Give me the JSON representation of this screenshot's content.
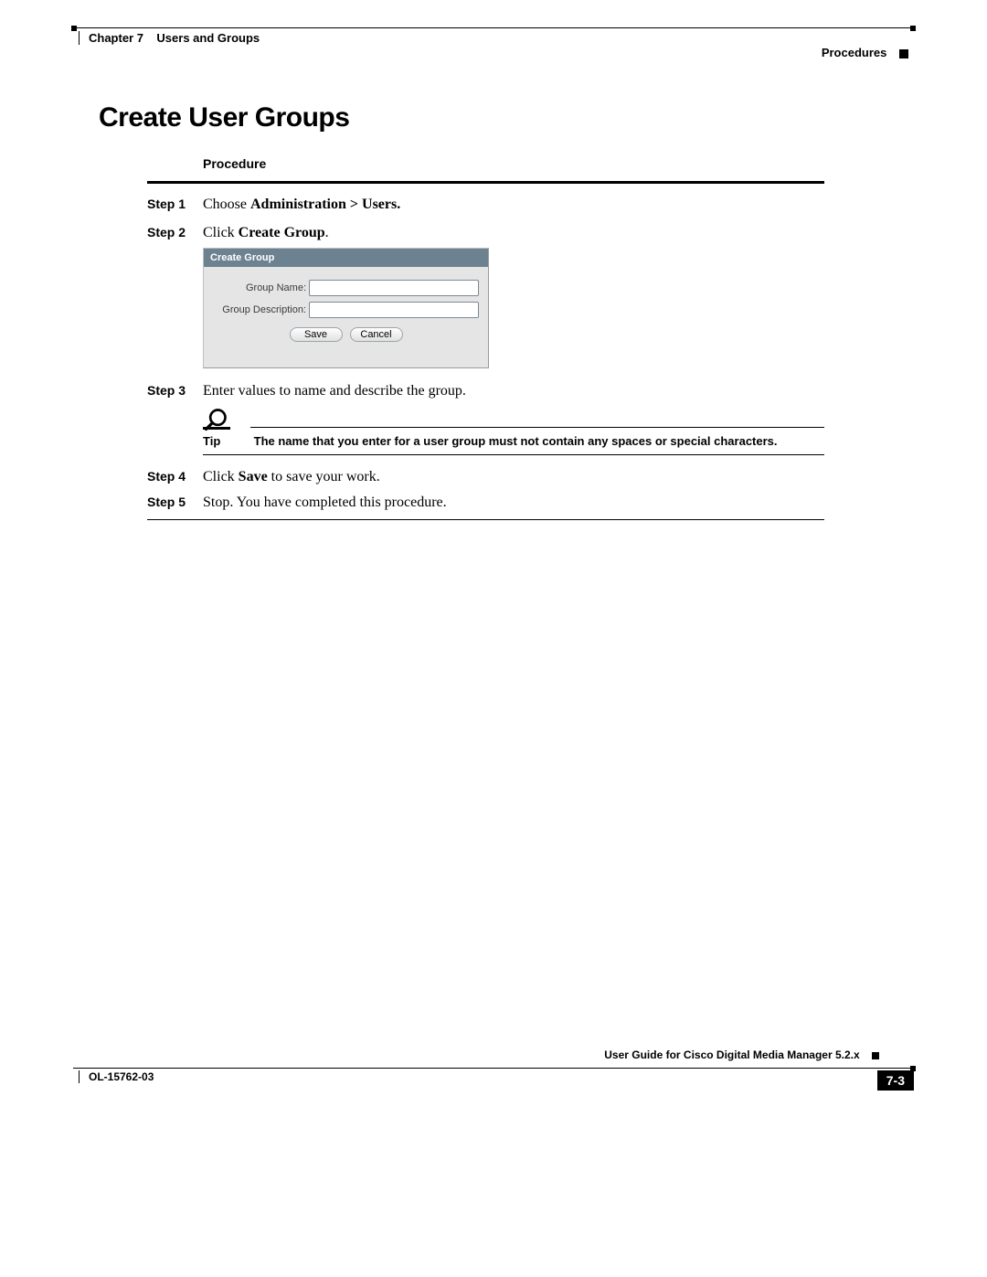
{
  "header": {
    "chapter": "Chapter 7",
    "chapter_title": "Users and Groups",
    "section": "Procedures"
  },
  "title": "Create User Groups",
  "procedure": {
    "heading": "Procedure",
    "steps": [
      {
        "label": "Step 1",
        "prefix": "Choose ",
        "bold": "Administration > Users.",
        "suffix": ""
      },
      {
        "label": "Step 2",
        "prefix": "Click ",
        "bold": "Create Group",
        "suffix": "."
      },
      {
        "label": "Step 3",
        "plain": "Enter values to name and describe the group."
      },
      {
        "label": "Step 4",
        "prefix": "Click ",
        "bold": "Save",
        "suffix": " to save your work."
      },
      {
        "label": "Step 5",
        "plain": "Stop. You have completed this procedure."
      }
    ]
  },
  "dialog": {
    "title": "Create Group",
    "field1_label": "Group Name:",
    "field2_label": "Group Description:",
    "save_label": "Save",
    "cancel_label": "Cancel"
  },
  "tip": {
    "label": "Tip",
    "text": "The name that you enter for a user group must not contain any spaces or special characters."
  },
  "footer": {
    "guide": "User Guide for Cisco Digital Media Manager 5.2.x",
    "docnum": "OL-15762-03",
    "pagenum": "7-3"
  }
}
